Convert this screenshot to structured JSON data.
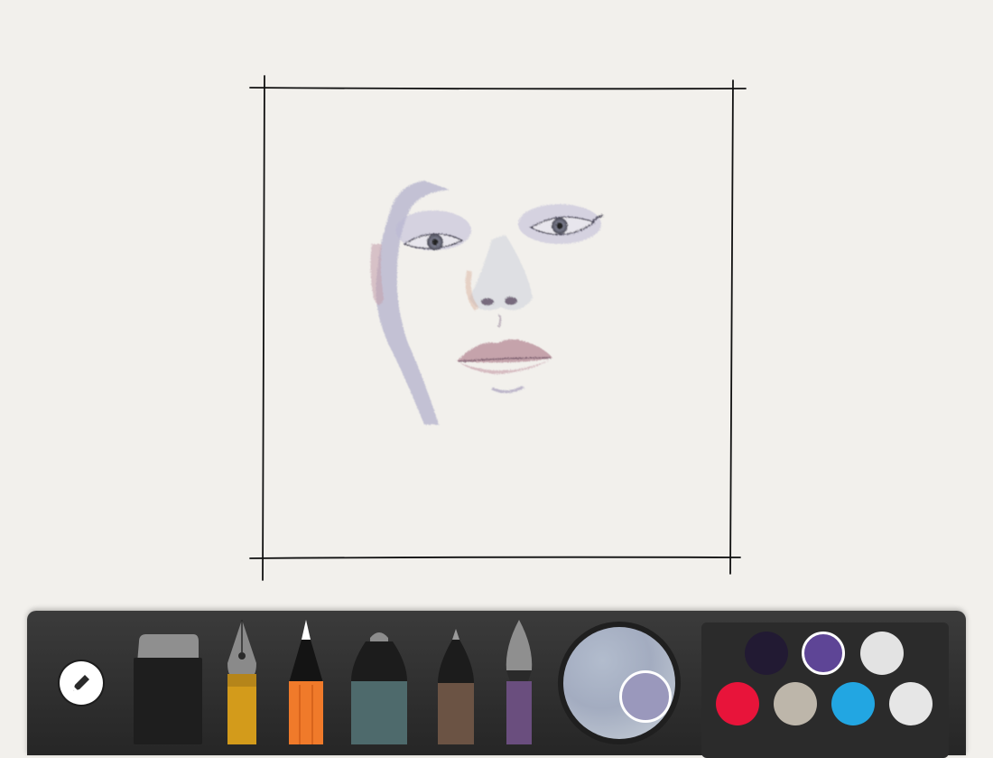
{
  "app": {
    "canvas": {
      "artwork": "face-sketch",
      "frame_color": "#111111"
    },
    "toolbar": {
      "menu_icon": "pencil-icon",
      "tools": [
        {
          "name": "eraser",
          "icon": "eraser-icon"
        },
        {
          "name": "fountain-pen",
          "icon": "fountain-pen-icon"
        },
        {
          "name": "pencil",
          "icon": "pencil-tool-icon",
          "selected": true
        },
        {
          "name": "marker",
          "icon": "marker-icon"
        },
        {
          "name": "fineliner",
          "icon": "fineliner-icon"
        },
        {
          "name": "brush",
          "icon": "brush-icon"
        }
      ],
      "mixer": {
        "current_color": "#9a98bc"
      },
      "palette": {
        "colors": [
          "#221a33",
          "#5e4596",
          "#e3e3e3",
          "#e8143a",
          "#bdb6aa",
          "#22a6e2",
          "#e6e6e6"
        ],
        "selected_index": 1
      }
    }
  }
}
